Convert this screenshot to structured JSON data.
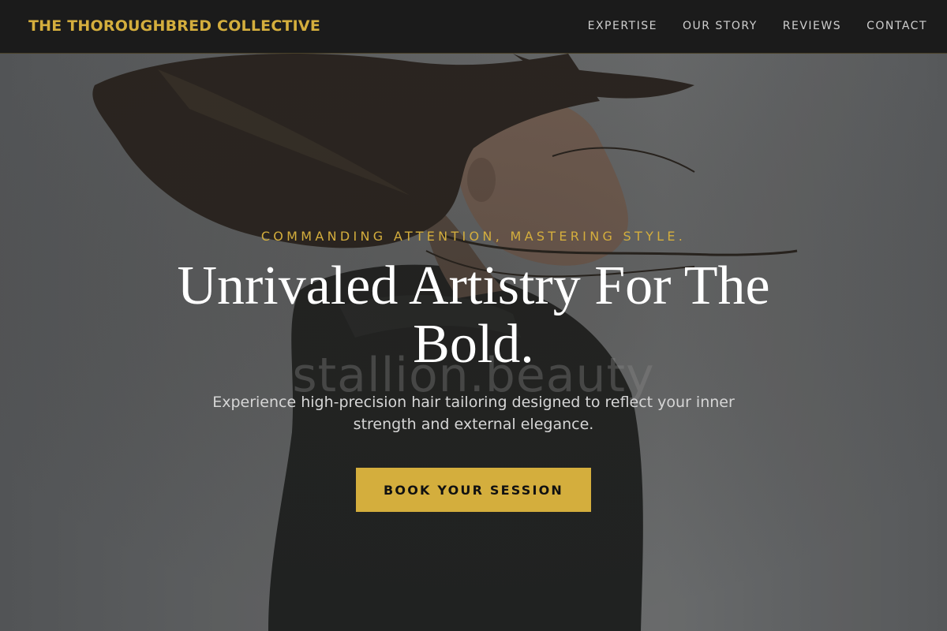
{
  "header": {
    "brand": "THE THOROUGHBRED COLLECTIVE",
    "nav": [
      {
        "label": "EXPERTISE"
      },
      {
        "label": "OUR STORY"
      },
      {
        "label": "REVIEWS"
      },
      {
        "label": "CONTACT"
      }
    ]
  },
  "hero": {
    "tagline": "COMMANDING ATTENTION, MASTERING STYLE.",
    "headline": "Unrivaled Artistry For The Bold.",
    "watermark": "stallion.beauty",
    "subtext": "Experience high-precision hair tailoring designed to reflect your inner strength and external elegance.",
    "cta_label": "BOOK YOUR SESSION",
    "image": "woman-with-flowing-hair-photo"
  },
  "colors": {
    "accent": "#d4ae3d",
    "header_bg": "#1b1b1b",
    "text_light": "#ffffff"
  }
}
